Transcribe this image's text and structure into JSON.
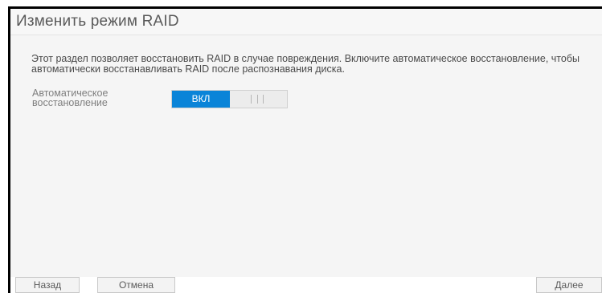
{
  "dialog": {
    "title": "Изменить режим RAID",
    "description": "Этот раздел позволяет восстановить RAID в случае повреждения. Включите автоматическое восстановление, чтобы автоматически восстанавливать RAID после распознавания диска.",
    "auto_recovery": {
      "label": "Автоматическое восстановление",
      "toggle_on_label": "ВКЛ",
      "state": "on"
    }
  },
  "footer": {
    "back_label": "Назад",
    "cancel_label": "Отмена",
    "next_label": "Далее"
  },
  "colors": {
    "toggle_on": "#0a84d8",
    "content_bg": "#f5f5f5"
  }
}
